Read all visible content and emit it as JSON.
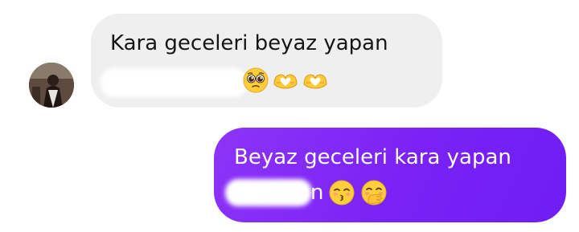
{
  "conversation": {
    "incoming": {
      "sender_avatar": "contact-avatar",
      "text_line1": "Kara geceleri beyaz yapan",
      "emojis": [
        "pleading-face-icon",
        "heart-hands-icon",
        "heart-hands-icon"
      ],
      "bubble_color": "#efefef",
      "text_color": "#161616"
    },
    "outgoing": {
      "text_line1": "Beyaz geceleri kara yapan",
      "partial_text": "n",
      "emojis": [
        "kissing-smiling-eyes-icon",
        "hand-over-mouth-icon"
      ],
      "bubble_gradient": [
        "#8d34f7",
        "#6f1df3"
      ],
      "text_color": "#ffffff"
    }
  }
}
